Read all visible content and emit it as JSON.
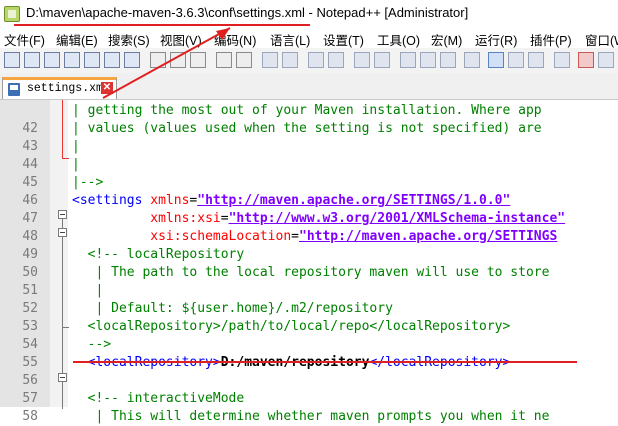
{
  "window": {
    "title": "D:\\maven\\apache-maven-3.6.3\\conf\\settings.xml - Notepad++ [Administrator]"
  },
  "menu": [
    "文件(F)",
    "编辑(E)",
    "搜索(S)",
    "视图(V)",
    "编码(N)",
    "语言(L)",
    "设置(T)",
    "工具(O)",
    "宏(M)",
    "运行(R)",
    "插件(P)",
    "窗口(W"
  ],
  "tab": {
    "label": "settings.xml",
    "close_glyph": "✕"
  },
  "editor": {
    "lines": [
      {
        "num": "",
        "parts": [
          {
            "c": "cm",
            "t": "| getting the most out of your Maven installation. Where app"
          }
        ]
      },
      {
        "num": "42",
        "parts": [
          {
            "c": "cm",
            "t": "| values (values used when the setting is not specified) are"
          }
        ]
      },
      {
        "num": "43",
        "parts": [
          {
            "c": "cm",
            "t": "|"
          }
        ]
      },
      {
        "num": "44",
        "parts": [
          {
            "c": "cm",
            "t": "|"
          }
        ]
      },
      {
        "num": "45",
        "parts": [
          {
            "c": "cm",
            "t": "|-->"
          }
        ]
      },
      {
        "num": "46",
        "parts": [
          {
            "c": "tg",
            "t": "<settings "
          },
          {
            "c": "at",
            "t": "xmlns"
          },
          {
            "c": "eq",
            "t": "="
          },
          {
            "c": "val",
            "t": "\"http://maven.apache.org/SETTINGS/1.0.0\""
          }
        ]
      },
      {
        "num": "47",
        "parts": [
          {
            "c": "eq",
            "t": "          "
          },
          {
            "c": "at",
            "t": "xmlns:xsi"
          },
          {
            "c": "eq",
            "t": "="
          },
          {
            "c": "val",
            "t": "\"http://www.w3.org/2001/XMLSchema-instance\""
          }
        ]
      },
      {
        "num": "48",
        "parts": [
          {
            "c": "eq",
            "t": "          "
          },
          {
            "c": "at",
            "t": "xsi:schemaLocation"
          },
          {
            "c": "eq",
            "t": "="
          },
          {
            "c": "val",
            "t": "\"http://maven.apache.org/SETTINGS"
          }
        ]
      },
      {
        "num": "49",
        "parts": [
          {
            "c": "cm",
            "t": "  <!-- localRepository"
          }
        ]
      },
      {
        "num": "50",
        "parts": [
          {
            "c": "cm",
            "t": "   | The path to the local repository maven will use to store"
          }
        ]
      },
      {
        "num": "51",
        "parts": [
          {
            "c": "cm",
            "t": "   |"
          }
        ]
      },
      {
        "num": "52",
        "parts": [
          {
            "c": "cm",
            "t": "   | Default: ${user.home}/.m2/repository"
          }
        ]
      },
      {
        "num": "53",
        "parts": [
          {
            "c": "cm",
            "t": "  <localRepository>/path/to/local/repo</localRepository>"
          }
        ]
      },
      {
        "num": "54",
        "parts": [
          {
            "c": "cm",
            "t": "  -->"
          }
        ]
      },
      {
        "num": "55",
        "parts": [
          {
            "c": "tg",
            "t": "  <localRepository>"
          },
          {
            "c": "txt",
            "t": "D:/maven/repository"
          },
          {
            "c": "tg",
            "t": "</localRepository>"
          }
        ]
      },
      {
        "num": "56",
        "parts": []
      },
      {
        "num": "57",
        "parts": [
          {
            "c": "cm",
            "t": "  <!-- interactiveMode"
          }
        ]
      },
      {
        "num": "58",
        "parts": [
          {
            "c": "cm",
            "t": "   | This will determine whether maven prompts you when it ne"
          }
        ]
      }
    ]
  },
  "colors": {
    "comment": "#008000",
    "tag": "#0000ff",
    "attribute": "#ff0000",
    "value": "#8000ff",
    "annotation": "#e02020",
    "tab_accent": "#f7a541"
  }
}
